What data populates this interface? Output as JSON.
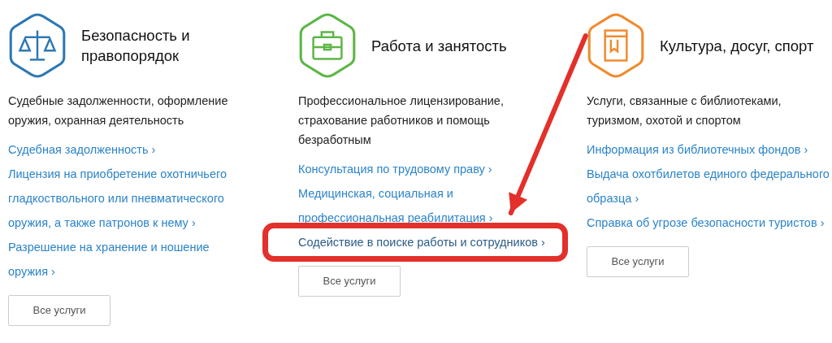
{
  "categories": [
    {
      "title": "Безопасность и правопорядок",
      "kind": "scales",
      "color": "#2d78b4",
      "description": "Судебные задолженности, оформление оружия, охранная деятельность",
      "links": [
        {
          "text": "Судебная задолженность ›",
          "highlighted": false
        },
        {
          "text": "Лицензия на приобретение охотничьего гладкоствольного или пневматического оружия, а также патронов к нему ›",
          "highlighted": false
        },
        {
          "text": "Разрешение на хранение и ношение оружия ›",
          "highlighted": false
        }
      ],
      "button": "Все услуги"
    },
    {
      "title": "Работа и занятость",
      "kind": "briefcase",
      "color": "#5cb646",
      "description": "Профессиональное лицензирование, страхование работников и помощь безработным",
      "links": [
        {
          "text": "Консультация по трудовому праву ›",
          "highlighted": false
        },
        {
          "text": "Медицинская, социальная и профессиональная реабилитация  ›",
          "highlighted": false
        },
        {
          "text": "Содействие в поиске работы и сотрудников ›",
          "highlighted": true
        }
      ],
      "button": "Все услуги"
    },
    {
      "title": "Культура, досуг, спорт",
      "kind": "book",
      "color": "#f08a2c",
      "description": "Услуги, связанные с библиотеками, туризмом, охотой и спортом",
      "links": [
        {
          "text": "Информация из библиотечных фондов ›",
          "highlighted": false
        },
        {
          "text": "Выдача охотбилетов единого федерального образца ›",
          "highlighted": false
        },
        {
          "text": "Справка об угрозе безопасности туристов ›",
          "highlighted": false
        }
      ],
      "button": "Все услуги"
    }
  ]
}
